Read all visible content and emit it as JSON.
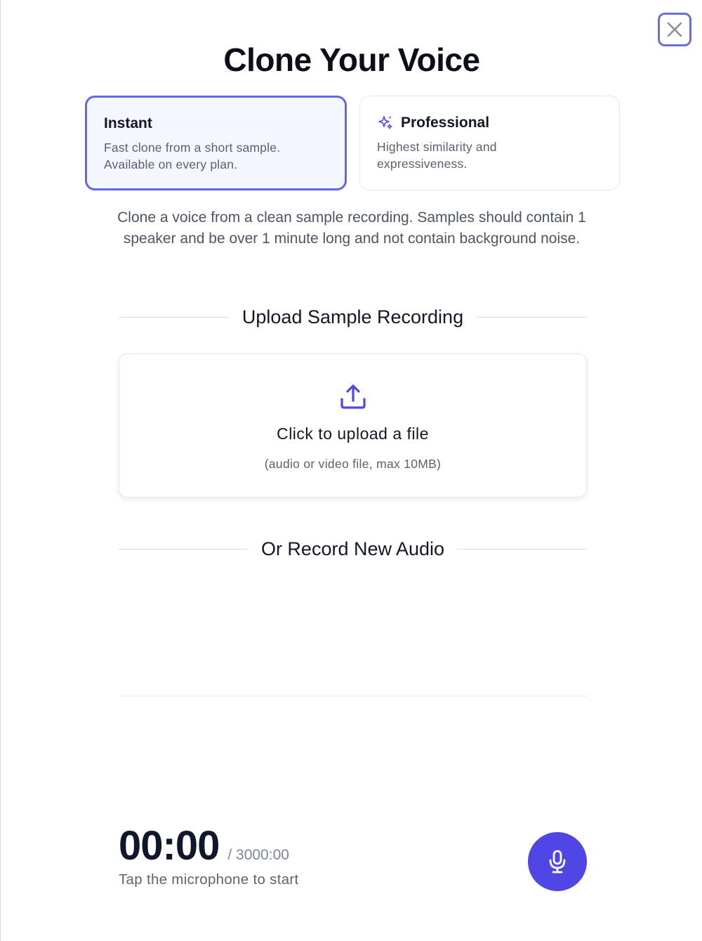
{
  "modal": {
    "title": "Clone Your Voice",
    "close_icon": "close-icon"
  },
  "modes": {
    "selected": "instant",
    "instant": {
      "title": "Instant",
      "description": "Fast clone from a short sample. Available on every plan."
    },
    "professional": {
      "icon": "sparkles-icon",
      "title": "Professional",
      "description": "Highest similarity and expressiveness."
    }
  },
  "intro": "Clone a voice from a clean sample recording. Samples should contain 1 speaker and be over 1 minute long and not contain background noise.",
  "upload": {
    "section_label": "Upload Sample Recording",
    "icon": "upload-icon",
    "prompt": "Click to upload a file",
    "hint": "(audio or video file, max 10MB)"
  },
  "record": {
    "section_label": "Or Record New Audio",
    "elapsed": "00:00",
    "max": "/ 3000:00",
    "hint": "Tap the microphone to start",
    "icon": "microphone-icon"
  },
  "colors": {
    "accent": "#4f46e5",
    "selected_border": "#6366f1",
    "selected_bg": "#f5f7ff"
  }
}
